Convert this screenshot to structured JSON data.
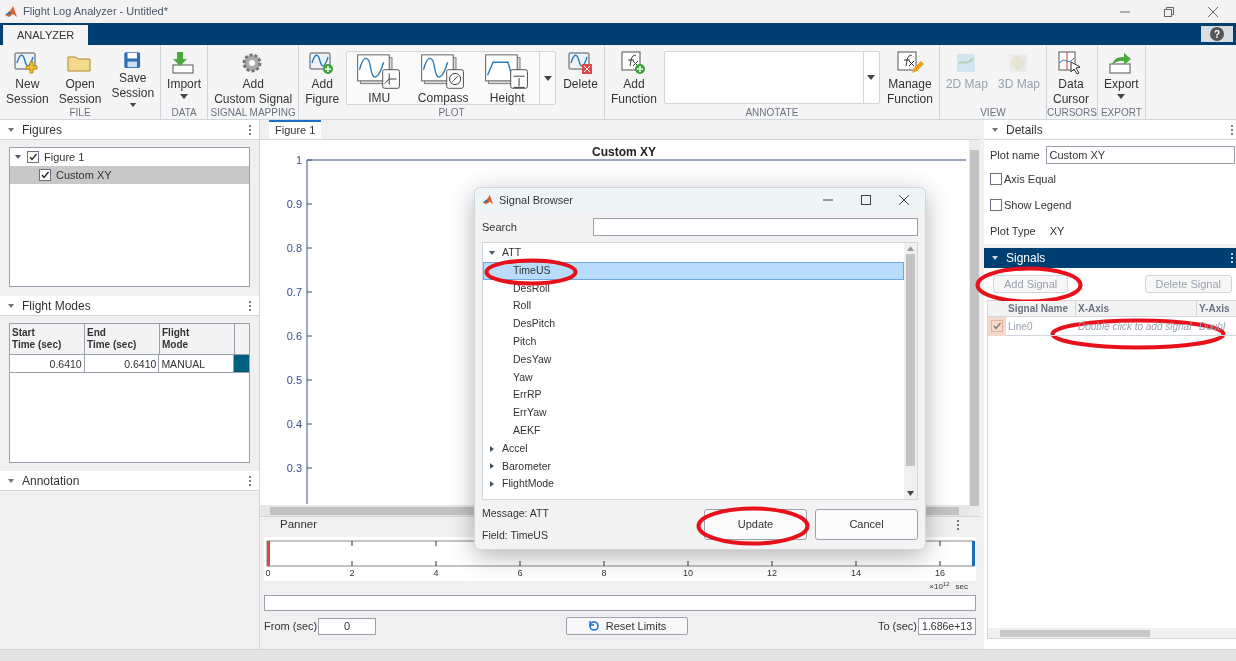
{
  "window": {
    "title": "Flight Log Analyzer - Untitled*",
    "help": "?"
  },
  "ribbon_tabs": [
    {
      "label": "ANALYZER",
      "selected": true
    }
  ],
  "toolstrip": [
    {
      "label": "FILE",
      "items": [
        {
          "kind": "button",
          "label": "New\nSession",
          "disabled": false,
          "dropdown": false
        },
        {
          "kind": "button",
          "label": "Open\nSession",
          "disabled": false,
          "dropdown": false
        },
        {
          "kind": "button",
          "label": "Save\nSession",
          "disabled": false,
          "dropdown": true
        }
      ]
    },
    {
      "label": "DATA",
      "items": [
        {
          "kind": "button",
          "label": "Import",
          "disabled": false,
          "dropdown": true
        }
      ]
    },
    {
      "label": "SIGNAL MAPPING",
      "items": [
        {
          "kind": "button",
          "label": "Add\nCustom Signal",
          "disabled": false,
          "dropdown": false
        }
      ]
    },
    {
      "label": "PLOT",
      "items": [
        {
          "kind": "button",
          "label": "Add\nFigure",
          "disabled": false,
          "dropdown": false
        },
        {
          "kind": "gallery",
          "entries": [
            {
              "label": "IMU"
            },
            {
              "label": "Compass"
            },
            {
              "label": "Height"
            }
          ]
        },
        {
          "kind": "button",
          "label": "Delete",
          "disabled": false,
          "dropdown": false
        }
      ]
    },
    {
      "label": "ANNOTATE",
      "items": [
        {
          "kind": "button",
          "label": "Add\nFunction",
          "disabled": false,
          "dropdown": false
        },
        {
          "kind": "list"
        },
        {
          "kind": "button",
          "label": "Manage\nFunction",
          "disabled": false,
          "dropdown": false
        }
      ]
    },
    {
      "label": "VIEW",
      "items": [
        {
          "kind": "button",
          "label": "2D Map",
          "disabled": true,
          "dropdown": false
        },
        {
          "kind": "button",
          "label": "3D Map",
          "disabled": true,
          "dropdown": false
        }
      ]
    },
    {
      "label": "CURSORS",
      "items": [
        {
          "kind": "button",
          "label": "Data\nCursor",
          "disabled": false,
          "dropdown": false
        }
      ]
    },
    {
      "label": "EXPORT",
      "items": [
        {
          "kind": "button",
          "label": "Export",
          "disabled": false,
          "dropdown": true
        }
      ]
    }
  ],
  "figures_panel": {
    "title": "Figures",
    "expanded": true,
    "tree": [
      {
        "label": "Figure 1",
        "checked": true,
        "expanded": true,
        "selected": false,
        "children": [
          {
            "label": "Custom XY",
            "checked": true,
            "selected": true
          }
        ]
      }
    ]
  },
  "flight_modes_panel": {
    "title": "Flight Modes",
    "expanded": true,
    "columns": [
      "Start\nTime (sec)",
      "End\nTime (sec)",
      "Flight\nMode"
    ],
    "rows": [
      {
        "cells": [
          "0.6410",
          "0.6410",
          "MANUAL"
        ],
        "color": "#00607f"
      }
    ]
  },
  "annotation_panel": {
    "title": "Annotation",
    "expanded": true
  },
  "figure_tabs": [
    {
      "label": "Figure 1",
      "selected": true
    }
  ],
  "plot": {
    "title": "Custom XY",
    "y_ticks": [
      "1",
      "0.9",
      "0.8",
      "0.7",
      "0.6",
      "0.5",
      "0.4",
      "0.3"
    ]
  },
  "panner": {
    "title": "Panner",
    "ticks": [
      "0",
      "2",
      "4",
      "6",
      "8",
      "10",
      "12",
      "14",
      "16"
    ],
    "exponent": "×10$^{12}$",
    "unit": "sec",
    "from_label": "From (sec)",
    "from_value": "0",
    "reset": "Reset Limits",
    "to_label": "To (sec)",
    "to_value": "1.686e+13"
  },
  "details_panel": {
    "title": "Details",
    "expanded": true,
    "plot_name_label": "Plot name",
    "plot_name": "Custom XY",
    "checkboxes": [
      {
        "label": "Axis Equal",
        "checked": false
      },
      {
        "label": "Show Legend",
        "checked": false
      }
    ],
    "plot_type_label": "Plot Type",
    "plot_type": "XY"
  },
  "signals_panel": {
    "title": "Signals",
    "expanded": true,
    "add_button": {
      "label": "Add Signal",
      "disabled": true
    },
    "delete_button": {
      "label": "Delete Signal",
      "disabled": true
    },
    "columns": [
      "Signal Name",
      "X-Axis",
      "Y-Axis"
    ],
    "rows": [
      {
        "checked": true,
        "name": "Line0",
        "x_placeholder": "Double click to add signal",
        "y_placeholder": "Doubl"
      }
    ]
  },
  "dialog": {
    "title": "Signal Browser",
    "search_label": "Search",
    "tree": [
      {
        "label": "ATT",
        "expanded": true,
        "children": [
          {
            "label": "TimeUS",
            "selected": true
          },
          {
            "label": "DesRoll",
            "selected": false
          },
          {
            "label": "Roll",
            "selected": false
          },
          {
            "label": "DesPitch",
            "selected": false
          },
          {
            "label": "Pitch",
            "selected": false
          },
          {
            "label": "DesYaw",
            "selected": false
          },
          {
            "label": "Yaw",
            "selected": false
          },
          {
            "label": "ErrRP",
            "selected": false
          },
          {
            "label": "ErrYaw",
            "selected": false
          },
          {
            "label": "AEKF",
            "selected": false
          }
        ]
      },
      {
        "label": "Accel",
        "expanded": false
      },
      {
        "label": "Barometer",
        "expanded": false
      },
      {
        "label": "FlightMode",
        "expanded": false
      }
    ],
    "message": "Message: ATT",
    "field": "Field: TimeUS",
    "buttons": [
      {
        "label": "Update"
      },
      {
        "label": "Cancel"
      }
    ]
  }
}
